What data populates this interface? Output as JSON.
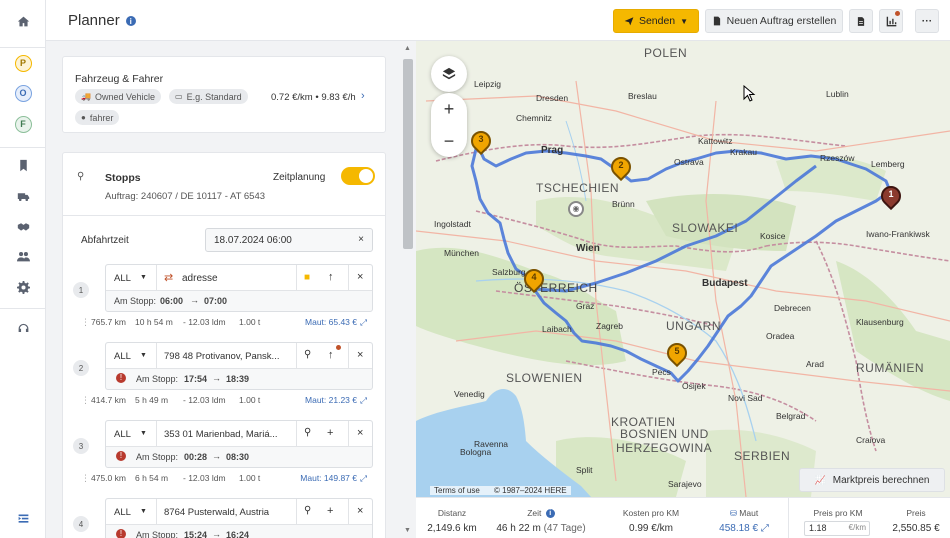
{
  "header": {
    "title": "Planner",
    "send_label": "Senden",
    "new_order_label": "Neuen Auftrag erstellen",
    "more_label": "···"
  },
  "rail": {
    "avatars": [
      "P",
      "O",
      "F"
    ]
  },
  "vehicle": {
    "title": "Fahrzeug & Fahrer",
    "vehicle_chip": "Owned Vehicle",
    "standard_chip": "E.g. Standard",
    "rate": "0.72 €/km • 9.83 €/h",
    "driver_chip": "fahrer"
  },
  "stops": {
    "title": "Stopps",
    "order": "Auftrag: 240607 / DE 10117 - AT 6543",
    "zeitplanung_label": "Zeitplanung",
    "departure_label": "Abfahrtzeit",
    "departure_value": "18.07.2024 06:00",
    "clear": "×",
    "items": [
      {
        "num": "1",
        "type": "ALL",
        "address": "adresse",
        "at_stop_label": "Am Stopp:",
        "from": "06:00",
        "to": "07:00"
      },
      {
        "num": "2",
        "type": "ALL",
        "address": "798 48 Protivanov, Pansk...",
        "at_stop_label": "Am Stopp:",
        "from": "17:54",
        "to": "18:39"
      },
      {
        "num": "3",
        "type": "ALL",
        "address": "353 01 Marienbad, Mariá...",
        "at_stop_label": "Am Stopp:",
        "from": "00:28",
        "to": "08:30"
      },
      {
        "num": "4",
        "type": "ALL",
        "address": "8764 Pusterwald, Austria",
        "at_stop_label": "Am Stopp:",
        "from": "15:24",
        "to": "16:24"
      }
    ],
    "segments": [
      {
        "dist": "765.7 km",
        "time": "10 h 54 m",
        "ldm": "- 12.03 ldm",
        "t": "1.00 t",
        "maut": "Maut: 65.43 €"
      },
      {
        "dist": "414.7 km",
        "time": "5 h 49 m",
        "ldm": "- 12.03 ldm",
        "t": "1.00 t",
        "maut": "Maut: 21.23 €"
      },
      {
        "dist": "475.0 km",
        "time": "6 h 54 m",
        "ldm": "- 12.03 ldm",
        "t": "1.00 t",
        "maut": "Maut: 149.87 €"
      }
    ]
  },
  "map": {
    "countries": [
      "POLEN",
      "TSCHECHIEN",
      "SLOWAKEI",
      "ÖSTERREICH",
      "UNGARN",
      "SLOWENIEN",
      "KROATIEN",
      "BOSNIEN UND",
      "HERZEGOWINA",
      "SERBIEN",
      "RUMÄNIEN"
    ],
    "cities": [
      "Leipzig",
      "Dresden",
      "Breslau",
      "Kattowitz",
      "Krakau",
      "Prag",
      "Brünn",
      "Wien",
      "München",
      "Budapest",
      "Graz",
      "Laibach",
      "Zagreb",
      "Venedig",
      "Lemberg",
      "Iwano-Frankiwsk",
      "Klausenburg",
      "Belgrad",
      "Salzburg",
      "Ingolstadt",
      "Ostrava",
      "Chemnitz",
      "Bologna",
      "Ravenna",
      "Split",
      "Sarajevo",
      "Kosice",
      "Debrecen",
      "Novi Sad",
      "Pecs",
      "Osijek",
      "Rzeszów",
      "Lublin",
      "Oradea",
      "Arad",
      "Craiova"
    ],
    "attribution_terms": "Terms of use",
    "attribution_copy": "© 1987–2024 HERE",
    "markt_label": "Marktpreis berechnen"
  },
  "stats": {
    "distanz_label": "Distanz",
    "distanz": "2,149.6 km",
    "zeit_label": "Zeit",
    "zeit": "46 h 22 m",
    "zeit_sub": "(47 Tage)",
    "kosten_label": "Kosten pro KM",
    "kosten": "0.99 €/km",
    "maut_label": "Maut",
    "maut": "458.18 €",
    "preis_km_label": "Preis pro KM",
    "preis_km": "1.18",
    "preis_km_unit": "€/km",
    "preis_label": "Preis",
    "preis": "2,550.85 €"
  },
  "colors": {
    "accent": "#f5b800",
    "link": "#3b6bb4",
    "route": "#4a78d8"
  }
}
